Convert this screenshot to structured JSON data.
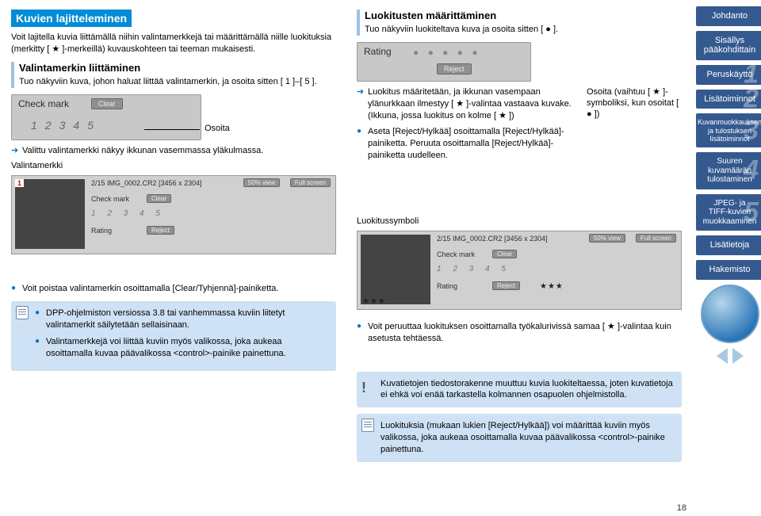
{
  "left": {
    "title": "Kuvien lajitteleminen",
    "intro": "Voit lajitella kuvia liittämällä niihin valintamerkkejä tai määrittämällä niille luokituksia (merkitty [ ★ ]-merkeillä) kuvauskohteen tai teeman mukaisesti.",
    "sub_title": "Valintamerkin liittäminen",
    "sub_body": "Tuo näkyviin kuva, johon haluat liittää valintamerkin, ja osoita sitten [ 1 ]–[ 5 ].",
    "fig": {
      "check": "Check mark",
      "clear": "Clear",
      "nums": [
        "1",
        "2",
        "3",
        "4",
        "5"
      ],
      "osoita": "Osoita"
    },
    "arrow_sel": "Valittu valintamerkki näkyy ikkunan vasemmassa yläkulmassa.",
    "marker_label": "Valintamerkki",
    "shot": {
      "info": "2/15 IMG_0002.CR2 [3456 x 2304]",
      "view50": "50% view",
      "full": "Full screen",
      "check": "Check mark",
      "clear": "Clear",
      "rating": "Rating",
      "reject": "Reject"
    },
    "bullet_remove": "Voit poistaa valintamerkin osoittamalla [Clear/Tyhjennä]-painiketta.",
    "note_a": "DPP-ohjelmiston versiossa 3.8 tai vanhemmassa kuviin liitetyt valintamerkit säilytetään sellaisinaan.",
    "note_b": "Valintamerkkejä voi liittää kuviin myös valikossa, joka aukeaa osoittamalla kuvaa päävalikossa <control>-painike painettuna."
  },
  "right": {
    "title": "Luokitusten määrittäminen",
    "intro": "Tuo näkyviin luokiteltava kuva ja osoita sitten [ ● ].",
    "fig": {
      "rating": "Rating",
      "reject": "Reject"
    },
    "hint_a": "Osoita (vaihtuu [ ★ ]-symboliksi, kun osoitat [ ● ])",
    "arrow_1": "Luokitus määritetään, ja ikkunan vasempaan ylänurkkaan ilmestyy [ ★ ]-valintaa vastaava kuvake. (Ikkuna, jossa luokitus on kolme [ ★ ])",
    "bullet_reject": "Aseta [Reject/Hylkää] osoittamalla [Reject/Hylkää]-painiketta. Peruuta osoittamalla [Reject/Hylkää]-painiketta uudelleen.",
    "sym_label": "Luokitussymboli",
    "shot": {
      "info": "2/15 IMG_0002.CR2 [3456 x 2304]",
      "view50": "50% view",
      "full": "Full screen",
      "check": "Check mark",
      "clear": "Clear",
      "rating": "Rating",
      "reject": "Reject",
      "stars": "★★★"
    },
    "bullet_undo": "Voit peruuttaa luokituksen osoittamalla työkalurivissä samaa [ ★ ]-valintaa kuin asetusta tehtäessä.",
    "warn": "Kuvatietojen tiedostorakenne muuttuu kuvia luokiteltaessa, joten kuvatietoja ei ehkä voi enää tarkastella kolmannen osapuolen ohjelmistolla.",
    "note": "Luokituksia (mukaan lukien [Reject/Hylkää]) voi määrittää kuviin myös valikossa, joka aukeaa osoittamalla kuvaa päävalikossa <control>-painike painettuna."
  },
  "sidebar": {
    "items": [
      {
        "label": "Johdanto"
      },
      {
        "label": "Sisällys\npääkohdittain"
      },
      {
        "label": "Peruskäyttö",
        "num": "1"
      },
      {
        "label": "Lisätoiminnot",
        "num": "2"
      },
      {
        "label": "Kuvanmuokkauksen\nja tulostuksen\nlisätoiminnot",
        "num": "3"
      },
      {
        "label": "Suuren\nkuvamäärän\ntulostaminen",
        "num": "4"
      },
      {
        "label": "JPEG- ja\nTIFF-kuvien\nmuokkaaminen",
        "num": "5"
      },
      {
        "label": "Lisätietoja"
      },
      {
        "label": "Hakemisto"
      }
    ]
  },
  "page_num": "18"
}
